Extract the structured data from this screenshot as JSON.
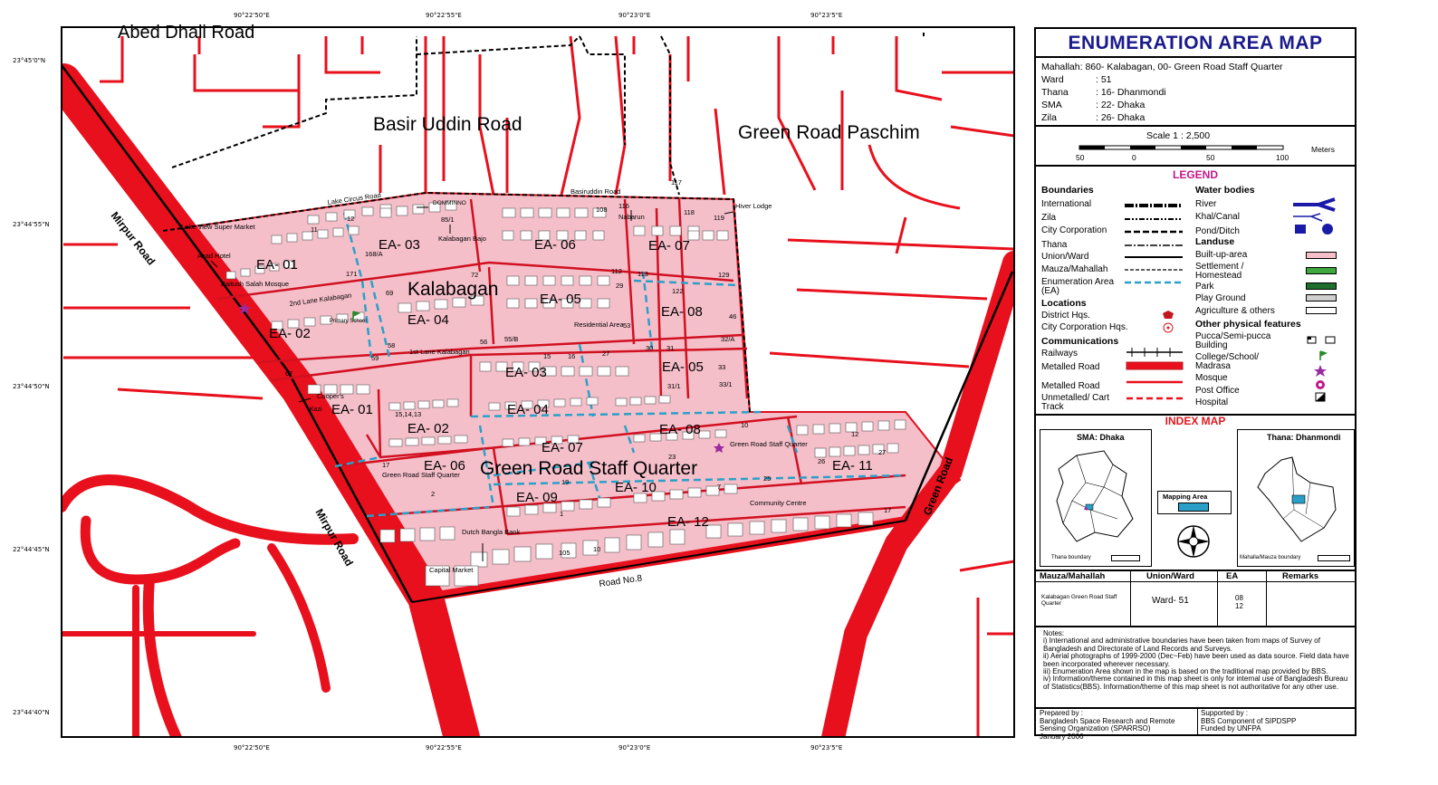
{
  "map": {
    "coords_top": [
      "90°22'50\"E",
      "90°22'55\"E",
      "90°23'0\"E",
      "90°23'5\"E"
    ],
    "coords_bottom": [
      "90°22'50\"E",
      "90°22'55\"E",
      "90°23'0\"E",
      "90°23'5\"E"
    ],
    "coords_left": [
      "23°45'0\"N",
      "23°44'55\"N",
      "23°44'50\"N",
      "22°44'45\"N",
      "23°44'40\"N"
    ],
    "big_labels": [
      "Abed Dhali Road",
      "Basir Uddin Road",
      "Green Road Paschim",
      "Kalabagan",
      "Green Road Staff Quarter"
    ],
    "roads": [
      "Mirpur Road",
      "Mirpur Road",
      "Green Road",
      "Road No.8",
      "Lake Circus Road",
      "Basiruddin Road",
      "2nd Lane Kalabagan",
      "1st Lane Kalabagan"
    ],
    "places": [
      "Lake View Super Market",
      "Azad Hotel",
      "Baitush Salah Mosque",
      "Primary School",
      "DOMMINNO",
      "Kalabagan Bajo",
      "Nabarun",
      "Hiver Lodge",
      "Residential Area",
      "Cooper's",
      "Kazi",
      "Green Road Staff Quarter",
      "Green Road Staff Quarter",
      "Community Centre",
      "Dutch Bangla Bank",
      "Capital Market"
    ],
    "ea_north": [
      "EA- 01",
      "EA- 02",
      "EA- 03",
      "EA- 04",
      "EA- 05",
      "EA- 06",
      "EA- 07",
      "EA- 08"
    ],
    "ea_south": [
      "EA- 01",
      "EA- 02",
      "EA- 03",
      "EA- 04",
      "EA- 05",
      "EA- 06",
      "EA- 07",
      "EA- 08",
      "EA- 09",
      "EA- 10",
      "EA- 11",
      "EA- 12"
    ],
    "holdings": [
      "11",
      "12",
      "171",
      "168/A",
      "69",
      "58",
      "59",
      "67",
      "85/1",
      "72",
      "56",
      "55/B",
      "108",
      "116",
      "118",
      "119",
      "117",
      "113",
      "112",
      "129",
      "122",
      "29",
      "53",
      "46",
      "32/A",
      "27",
      "30",
      "31",
      "33",
      "31/1",
      "33/1",
      "15",
      "16",
      "15,14,13",
      "10",
      "17",
      "2",
      "19",
      "1",
      "23",
      "25",
      "7",
      "26",
      "12",
      "27",
      "17",
      "105",
      "10"
    ]
  },
  "panel": {
    "title": "ENUMERATION AREA MAP",
    "mahallah": "Mahallah: 860- Kalabagan, 00- Green Road Staff Quarter",
    "rows": [
      {
        "k": "Ward",
        "v": ": 51"
      },
      {
        "k": "Thana",
        "v": ": 16- Dhanmondi"
      },
      {
        "k": "SMA",
        "v": ": 22- Dhaka"
      },
      {
        "k": "Zila",
        "v": ": 26- Dhaka"
      }
    ],
    "scale_label": "Scale 1 : 2,500",
    "scale_ticks": [
      "50",
      "0",
      "50",
      "100"
    ],
    "scale_unit": "Meters",
    "legend_title": "LEGEND",
    "boundaries_h": "Boundaries",
    "boundaries": [
      "International",
      "Zila",
      "City Corporation",
      "Thana",
      "Union/Ward",
      "Mauza/Mahallah",
      "Enumeration Area (EA)"
    ],
    "locations_h": "Locations",
    "locations": [
      "District Hqs.",
      "City Corporation Hqs."
    ],
    "comm_h": "Communications",
    "comm": [
      "Railways",
      "Metalled Road",
      "Metalled Road",
      "Unmetalled/ Cart Track"
    ],
    "water_h": "Water bodies",
    "water": [
      "River",
      "Khal/Canal",
      "Pond/Ditch"
    ],
    "landuse_h": "Landuse",
    "landuse": [
      "Built-up-area",
      "Settlement / Homestead",
      "Park",
      "Play Ground",
      "Agriculture & others"
    ],
    "other_h": "Other physical features",
    "other": [
      "Pucca/Semi-pucca Building",
      "College/School/ Madrasa",
      "Mosque",
      "Post Office",
      "Hospital"
    ],
    "index_title": "INDEX MAP",
    "index_left_title": "SMA: Dhaka",
    "index_left_caption": "Thana boundary",
    "index_mid_label": "Mapping Area",
    "index_right_title": "Thana: Dhanmondi",
    "index_right_caption": "Mahalla/Mauza boundary",
    "table_headers": [
      "Mauza/Mahallah",
      "Union/Ward",
      "EA",
      "Remarks"
    ],
    "table_row": {
      "mahallah": "Kalabagan Green Road Staff Quarter",
      "ward": "Ward- 51",
      "ea": "08\n12",
      "remarks": ""
    },
    "notes_title": "Notes:",
    "notes": [
      "i)  International and administrative boundaries have been taken from maps of Survey of Bangladesh and Directorate of Land Records and Surveys.",
      "ii)  Aerial photographs of 1999-2000 (Dec~Feb) have been used as data source. Field data have been incorporated wherever necessary.",
      "iii)  Enumeration Area shown in the map is based on the traditional map provided by BBS.",
      "iv)  Information/theme contained in this map sheet is only for internal use of Bangladesh Bureau of Statistics(BBS). Information/theme of this map sheet is not authoritative for any other use."
    ],
    "prepared_by": "Prepared by :",
    "prepared_org": "Bangladesh Space Research and Remote Sensing Organization (SPARRSO)",
    "prepared_date": "January 2006",
    "supported_by": "Supported by :",
    "supported_org": "BBS Component of SIPDSPP",
    "funded_by": "Funded by UNFPA"
  }
}
